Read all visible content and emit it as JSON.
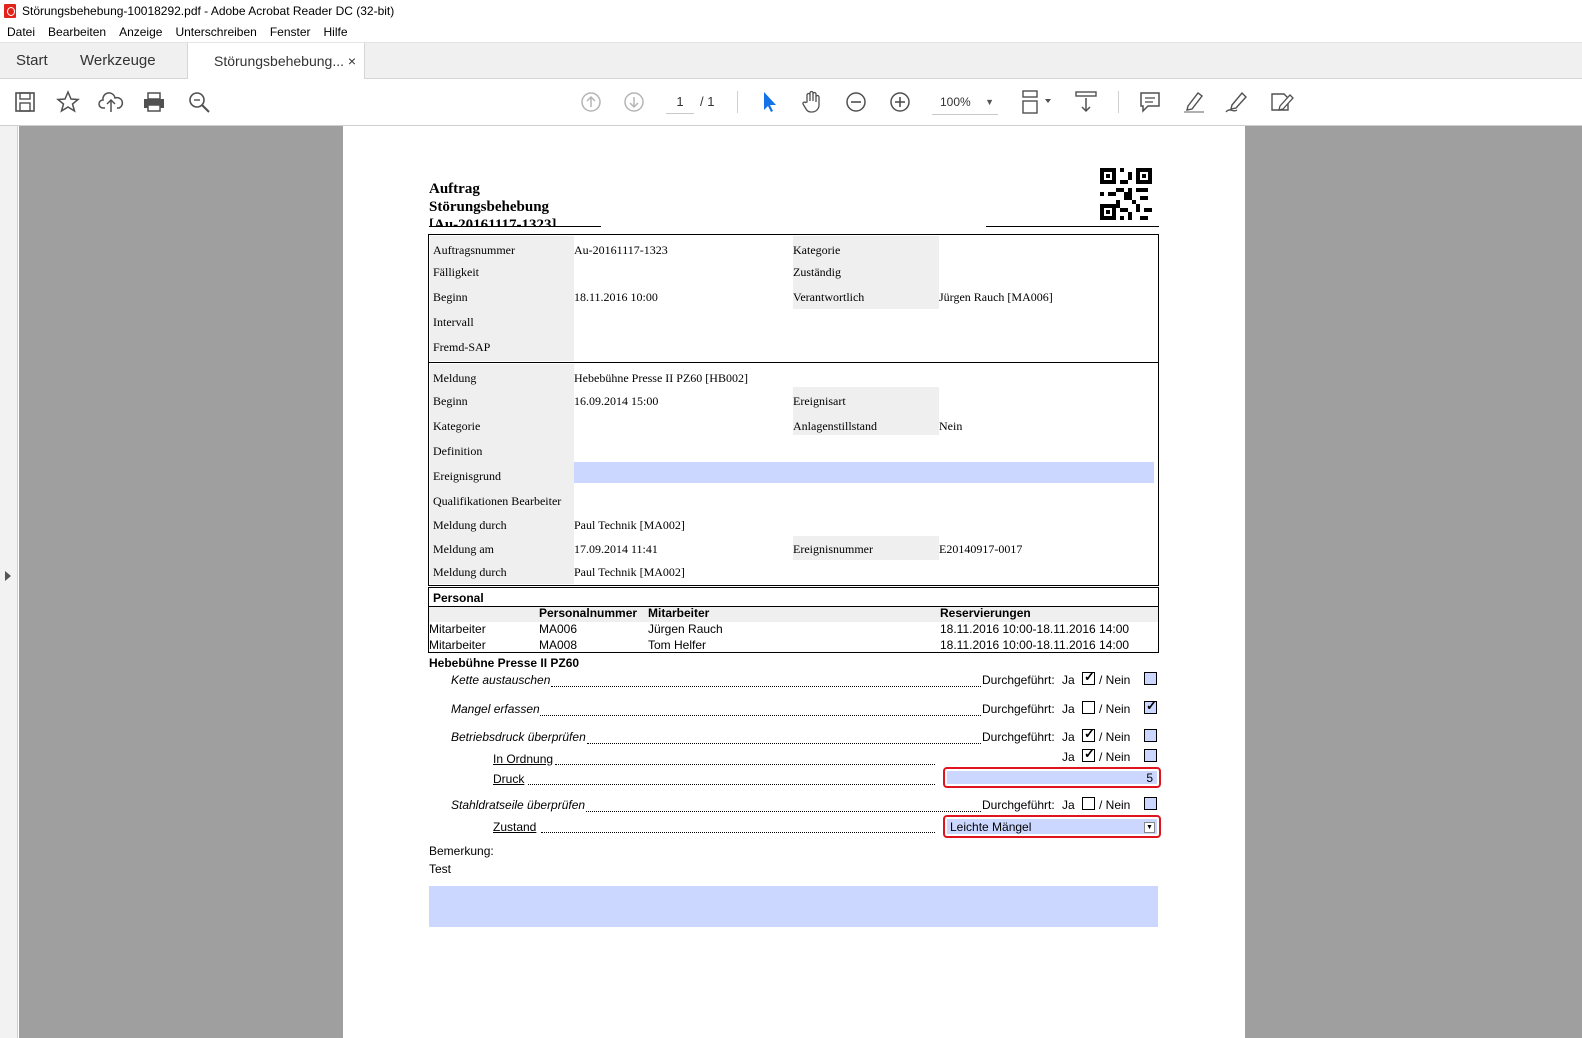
{
  "window": {
    "title": "Störungsbehebung-10018292.pdf - Adobe Acrobat Reader DC (32-bit)"
  },
  "menu": [
    "Datei",
    "Bearbeiten",
    "Anzeige",
    "Unterschreiben",
    "Fenster",
    "Hilfe"
  ],
  "tabs": {
    "start": "Start",
    "tools": "Werkzeuge",
    "doc": "Störungsbehebung...",
    "close": "×"
  },
  "toolbar": {
    "page_current": "1",
    "page_total": "/ 1",
    "zoom": "100%",
    "icons": [
      "save-icon",
      "bookmark-star-icon",
      "upload-cloud-icon",
      "print-icon",
      "zoom-search-icon",
      "page-up-icon",
      "page-down-icon",
      "select-cursor-icon",
      "hand-icon",
      "zoom-out-icon",
      "zoom-in-icon",
      "page-fit-icon",
      "scroll-mode-icon",
      "comment-icon",
      "highlight-pen-icon",
      "sign-pen-icon",
      "fill-sign-icon"
    ]
  },
  "doc": {
    "title1": "Auftrag",
    "title2": "Störungsbehebung",
    "title3": "[Au-20161117-1323]",
    "order": {
      "auftragsnummer_label": "Auftragsnummer",
      "auftragsnummer": "Au-20161117-1323",
      "faelligkeit_label": "Fälligkeit",
      "beginn_label": "Beginn",
      "beginn": "18.11.2016 10:00",
      "intervall_label": "Intervall",
      "fremdsap_label": "Fremd-SAP",
      "kategorie_label": "Kategorie",
      "zustaendig_label": "Zuständig",
      "verantwortlich_label": "Verantwortlich",
      "verantwortlich": "Jürgen Rauch [MA006]"
    },
    "report": {
      "meldung_label": "Meldung",
      "meldung": "Hebebühne Presse II PZ60 [HB002]",
      "beginn_label": "Beginn",
      "beginn": "16.09.2014 15:00",
      "kategorie_label": "Kategorie",
      "definition_label": "Definition",
      "ereignisgrund_label": "Ereignisgrund",
      "qualifikationen_label": "Qualifikationen Bearbeiter",
      "meldung_durch_label": "Meldung durch",
      "meldung_durch": "Paul Technik [MA002]",
      "meldung_am_label": "Meldung am",
      "meldung_am": "17.09.2014 11:41",
      "meldung_durch2_label": "Meldung durch",
      "meldung_durch2": "Paul Technik [MA002]",
      "ereignisart_label": "Ereignisart",
      "anlagenstillstand_label": "Anlagenstillstand",
      "anlagenstillstand": "Nein",
      "ereignisnummer_label": "Ereignisnummer",
      "ereignisnummer": "E20140917-0017"
    },
    "personnel": {
      "heading": "Personal",
      "headers": [
        "Personalnummer",
        "Mitarbeiter",
        "Reservierungen"
      ],
      "rows": [
        {
          "role": "Mitarbeiter",
          "nr": "MA006",
          "name": "Jürgen Rauch",
          "res": "18.11.2016 10:00-18.11.2016 14:00"
        },
        {
          "role": "Mitarbeiter",
          "nr": "MA008",
          "name": "Tom Helfer",
          "res": "18.11.2016 10:00-18.11.2016 14:00"
        }
      ]
    },
    "checklist": {
      "heading": "Hebebühne Presse II PZ60",
      "durchgefuehrt": "Durchgeführt:",
      "ja": "Ja",
      "nein": "/ Nein",
      "items": [
        {
          "label": "Kette austauschen",
          "ja": true,
          "nein": false
        },
        {
          "label": "Mangel erfassen",
          "ja": false,
          "nein": true
        },
        {
          "label": "Betriebsdruck überprüfen",
          "ja": true,
          "nein": false
        },
        {
          "label": "Stahldratseile überprüfen",
          "ja": false,
          "nein": false
        }
      ],
      "in_ordnung": "In Ordnung",
      "in_ordnung_ja": true,
      "druck": "Druck",
      "druck_value": "5",
      "zustand": "Zustand",
      "zustand_value": "Leichte Mängel"
    },
    "bemerkung_label": "Bemerkung:",
    "bemerkung": "Test"
  }
}
